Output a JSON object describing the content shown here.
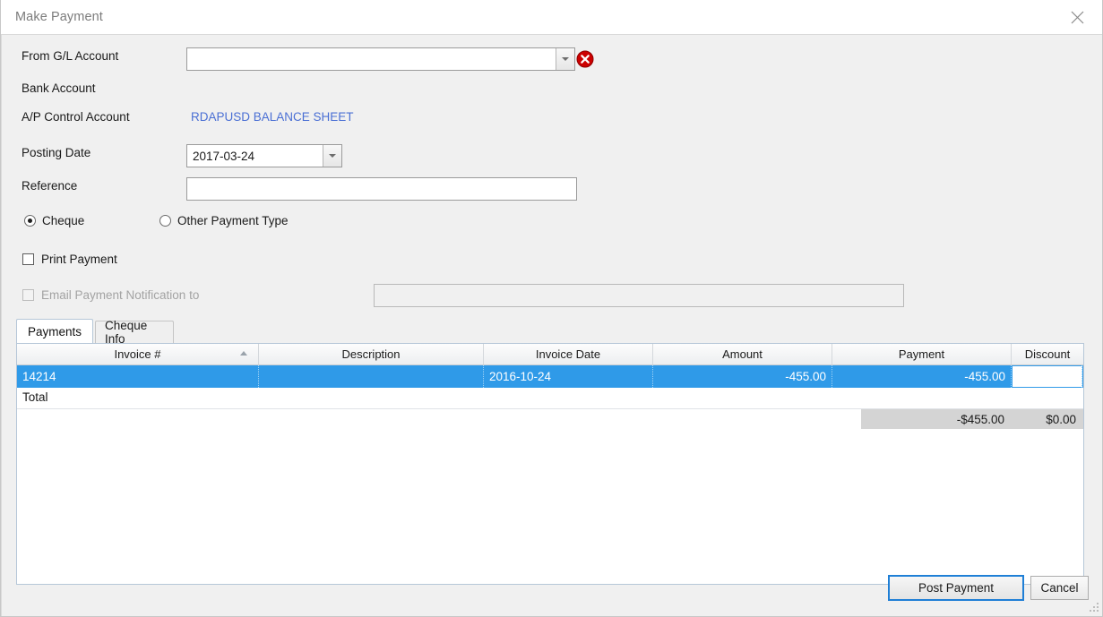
{
  "window": {
    "title": "Make Payment",
    "close_icon": "close-icon",
    "resize_grip": "resize-grip"
  },
  "form": {
    "from_gl_account": {
      "label": "From G/L Account",
      "value": "",
      "placeholder": "",
      "dropdown_icon": "chevron-down-icon",
      "error_icon": "error-circle-icon",
      "error_color": "#cc0000"
    },
    "bank_account": {
      "label": "Bank Account",
      "value": ""
    },
    "ap_control_account": {
      "label": "A/P Control Account",
      "value": "RDAPUSD BALANCE SHEET",
      "link_color": "#4a6fd4"
    },
    "posting_date": {
      "label": "Posting Date",
      "value": "2017-03-24",
      "dropdown_icon": "chevron-down-icon"
    },
    "reference": {
      "label": "Reference",
      "value": "",
      "placeholder": ""
    },
    "payment_type": {
      "options": [
        {
          "label": "Cheque",
          "selected": true
        },
        {
          "label": "Other Payment Type",
          "selected": false
        }
      ]
    },
    "print_payment": {
      "label": "Print Payment",
      "checked": false,
      "disabled": false
    },
    "email_notification": {
      "label": "Email Payment Notification to",
      "checked": false,
      "disabled": true,
      "email_value": "",
      "email_placeholder": ""
    }
  },
  "tabs": [
    {
      "label": "Payments",
      "active": true
    },
    {
      "label": "Cheque Info",
      "active": false
    }
  ],
  "grid": {
    "sort_icon": "sort-ascending-icon",
    "sort_column": "Invoice #",
    "columns": [
      {
        "label": "Invoice #",
        "align": "left"
      },
      {
        "label": "Description",
        "align": "left"
      },
      {
        "label": "Invoice Date",
        "align": "left"
      },
      {
        "label": "Amount",
        "align": "right"
      },
      {
        "label": "Payment",
        "align": "right"
      },
      {
        "label": "Discount",
        "align": "right"
      }
    ],
    "rows": [
      {
        "selected": true,
        "invoice_number": "14214",
        "description": "",
        "invoice_date": "2016-10-24",
        "amount": "-455.00",
        "payment": "-455.00",
        "discount": ""
      }
    ],
    "total_label": "Total",
    "totals": {
      "amount": "",
      "payment": "-$455.00",
      "discount": "$0.00"
    },
    "selection_color": "#2f9ae8"
  },
  "footer": {
    "post_payment_label": "Post Payment",
    "cancel_label": "Cancel"
  }
}
